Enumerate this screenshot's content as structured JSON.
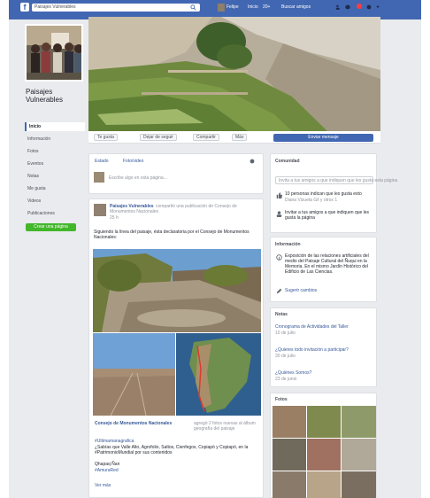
{
  "topbar": {
    "search_value": "Paisajes Vulnerables",
    "nav_links": [
      "Felipe",
      "Inicio",
      "Buscar amigos"
    ],
    "nav_link_1_sub": "20+"
  },
  "profile": {
    "name": "Paisajes Vulnerables"
  },
  "left_nav": {
    "items": [
      "Inicio",
      "Información",
      "Fotos",
      "Eventos",
      "Notas",
      "Me gusta",
      "Videos",
      "Publicaciones"
    ],
    "promote_label": "Crear una página"
  },
  "actions": {
    "buttons": [
      "Te gusta",
      "Dejar de seguir",
      "Compartir",
      "Más"
    ],
    "message_button": "Enviar mensaje"
  },
  "composer": {
    "tab_status": "Estado",
    "tab_photo": "Foto/video",
    "placeholder": "Escribe algo en esta página..."
  },
  "post": {
    "author": "Paisajes Vulnerables",
    "meta": "compartió una publicación de Consejo de Monumentos Nacionales",
    "time": "25 h",
    "text": "Siguiendo la línea del paisaje, ésta declaratoria por el Consejo de Monumentos Nacionales:",
    "link_title": "Consejo de Monumentos Nacionales",
    "link_meta": "agregó 2 fotos nuevas al álbum geografía del paisaje",
    "body_lines": [
      "#Ultimamanagrafica",
      "¿Sabías que Valle Alto, Agrofolio, Saltos, Cienfegos, Copiapó y Copiapó, en la #PatrimonioMundial por sus contenidos",
      "Qhapaq Ñan",
      "#AmuraRed"
    ],
    "see_more": "Ver más"
  },
  "community": {
    "title": "Comunidad",
    "invite": "Invita a tus amigos a que indiquen que les gusta esta página",
    "likes": "10 personas indican que les gusta esto",
    "likes_sub": "Diana Vizueta Gil y otros 1",
    "invite_link": "Invitar a tus amigos a que indiquen que les gusta la página"
  },
  "info": {
    "title": "Información",
    "about": "Exposición de las relaciones artificiales del medio del Paisaje Cultural del Ñuqui en la Memoria. En el mismo Jardín Histórico del Edificio de Las Ciencias.",
    "suggest": "Sugerir cambios"
  },
  "notes": {
    "title": "Notas",
    "items": [
      {
        "title": "Cronograma de Actividades del Taller",
        "date": "10 de julio"
      },
      {
        "title": "¿Quieres todo invitación a participar?",
        "date": "30 de julio"
      },
      {
        "title": "¿Quiénes Somos?",
        "date": "23 de junio"
      }
    ]
  },
  "photos": {
    "title": "Fotos"
  },
  "colors": {
    "brand": "#4267b2",
    "promote": "#42b72a",
    "page_bg": "#e9ebee"
  }
}
